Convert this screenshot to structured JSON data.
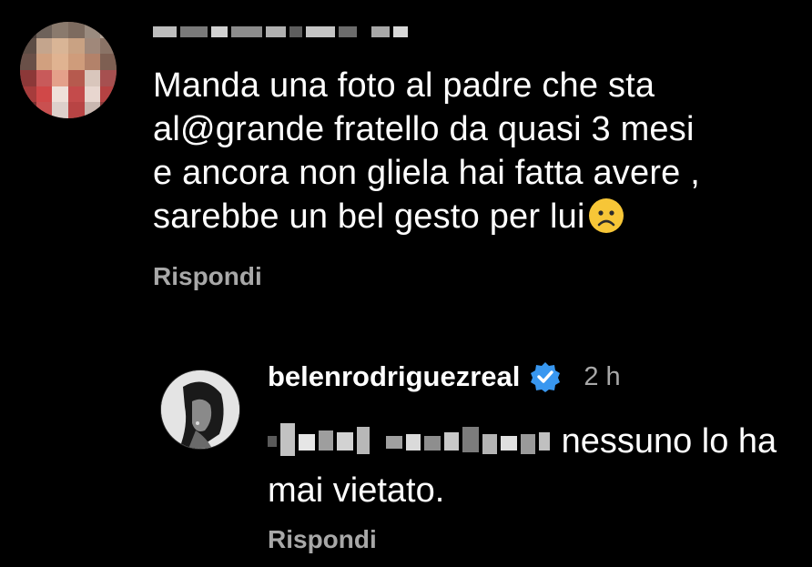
{
  "comments": [
    {
      "text": "Manda una foto al padre che sta\nal@grande fratello da quasi 3 mesi\ne ancora non gliela hai fatta avere ,\nsarebbe un bel gesto per lui",
      "emoji": "frowning-face-icon",
      "reply_label": "Rispondi"
    },
    {
      "username": "belenrodriguezreal",
      "time": "2 h",
      "text": "nessuno lo ha mai vietato.",
      "reply_label": "Rispondi"
    }
  ],
  "colors": {
    "background": "#000000",
    "text": "#ffffff",
    "secondary": "#a8a8a8",
    "verified": "#3897f0"
  }
}
